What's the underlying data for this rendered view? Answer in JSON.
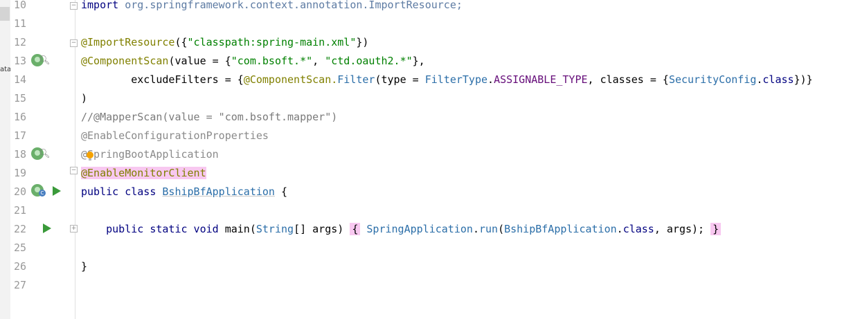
{
  "left_strip": {
    "label": "ata."
  },
  "lines": [
    {
      "num": "10",
      "tokens": [
        {
          "t": "import",
          "c": "kw"
        },
        {
          "t": " "
        },
        {
          "t": "org.springframework.context.annotation.",
          "c": "pkg"
        },
        {
          "t": "ImportResource",
          "c": "pkg"
        },
        {
          "t": ";",
          "c": "pkg"
        }
      ]
    },
    {
      "num": "11",
      "tokens": []
    },
    {
      "num": "12",
      "tokens": [
        {
          "t": "@ImportResource",
          "c": "ann"
        },
        {
          "t": "({"
        },
        {
          "t": "\"classpath:spring-main.xml\"",
          "c": "str"
        },
        {
          "t": "})"
        }
      ]
    },
    {
      "num": "13",
      "tokens": [
        {
          "t": "@ComponentScan",
          "c": "ann"
        },
        {
          "t": "(value = {"
        },
        {
          "t": "\"com.bsoft.*\"",
          "c": "str"
        },
        {
          "t": ", "
        },
        {
          "t": "\"ctd.oauth2.*\"",
          "c": "str"
        },
        {
          "t": "},"
        }
      ]
    },
    {
      "num": "14",
      "tokens": [
        {
          "t": "        excludeFilters = {"
        },
        {
          "t": "@ComponentScan.",
          "c": "ann"
        },
        {
          "t": "Filter",
          "c": "type"
        },
        {
          "t": "(type = "
        },
        {
          "t": "FilterType",
          "c": "type"
        },
        {
          "t": "."
        },
        {
          "t": "ASSIGNABLE_TYPE",
          "c": "field"
        },
        {
          "t": ", classes = {"
        },
        {
          "t": "SecurityConfig",
          "c": "type"
        },
        {
          "t": "."
        },
        {
          "t": "class",
          "c": "kw"
        },
        {
          "t": "})}"
        }
      ]
    },
    {
      "num": "15",
      "tokens": [
        {
          "t": ")"
        }
      ]
    },
    {
      "num": "16",
      "tokens": [
        {
          "t": "//@MapperScan(value = \"com.bsoft.mapper\")",
          "c": "comment"
        }
      ]
    },
    {
      "num": "17",
      "tokens": [
        {
          "t": "@EnableConfigurationProperties",
          "c": "annlight"
        }
      ]
    },
    {
      "num": "18",
      "tokens": [
        {
          "t": "@SpringBootApplication",
          "c": "annlight"
        }
      ]
    },
    {
      "num": "19",
      "tokens": [
        {
          "t": "@EnableMonitorClient",
          "c": "ann hl"
        }
      ]
    },
    {
      "num": "20",
      "tokens": [
        {
          "t": "public class ",
          "c": "kw"
        },
        {
          "t": "BshipBfApplication",
          "c": "cls"
        },
        {
          "t": " {"
        }
      ]
    },
    {
      "num": "21",
      "tokens": []
    },
    {
      "num": "22",
      "tokens": [
        {
          "t": "    "
        },
        {
          "t": "public static void ",
          "c": "kw"
        },
        {
          "t": "main("
        },
        {
          "t": "String",
          "c": "type"
        },
        {
          "t": "[] args) "
        },
        {
          "t": "{",
          "c": "hlbrace"
        },
        {
          "t": " "
        },
        {
          "t": "SpringApplication",
          "c": "type"
        },
        {
          "t": "."
        },
        {
          "t": "run",
          "c": "type"
        },
        {
          "t": "("
        },
        {
          "t": "BshipBfApplication",
          "c": "type"
        },
        {
          "t": "."
        },
        {
          "t": "class",
          "c": "kw"
        },
        {
          "t": ", args); "
        },
        {
          "t": "}",
          "c": "hlbrace"
        }
      ]
    },
    {
      "num": "25",
      "tokens": []
    },
    {
      "num": "26",
      "tokens": [
        {
          "t": "}"
        }
      ]
    },
    {
      "num": "27",
      "tokens": []
    }
  ]
}
